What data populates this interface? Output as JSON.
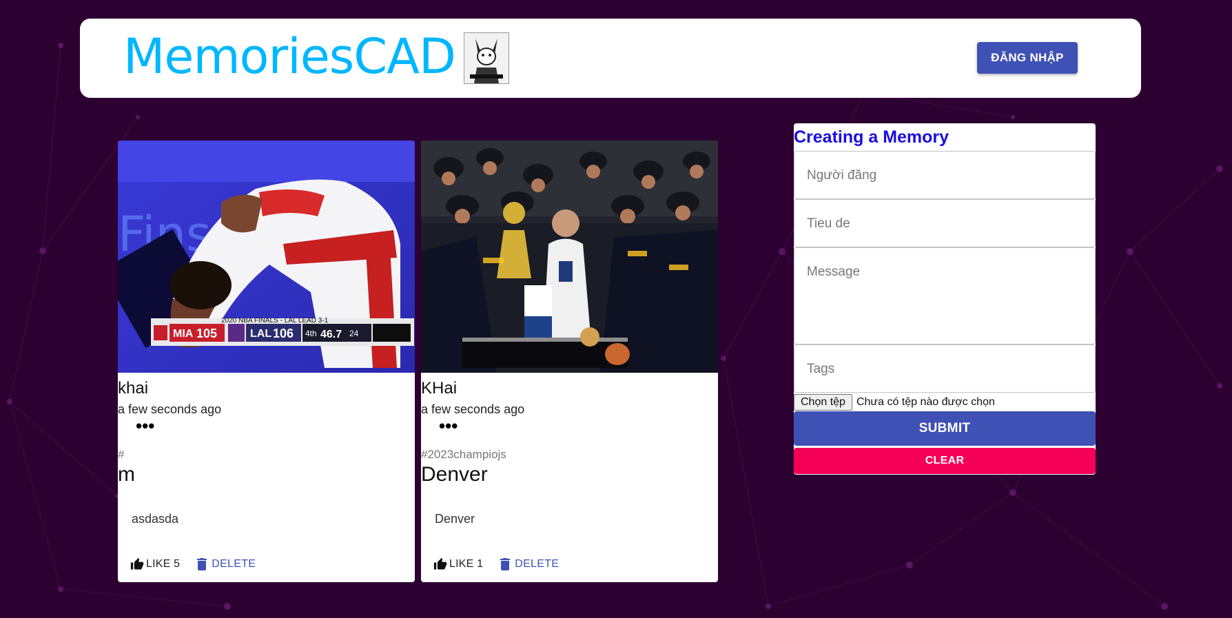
{
  "header": {
    "brand": "MemoriesCAD",
    "login_label": "ĐĂNG NHẬP"
  },
  "posts": [
    {
      "author": "khai",
      "time": "a few seconds ago",
      "more": "•••",
      "tags": "#",
      "title": "m",
      "message": "asdasda",
      "like_label": "LIKE 5",
      "delete_label": "DELETE",
      "image": {
        "scoreboard_header": "2020 NBA FINALS - LAL LEAD 3-1",
        "team1": "MIA",
        "score1": "105",
        "team2": "LAL",
        "score2": "106",
        "quarter": "4th",
        "clock": "46.7",
        "shot_clock": "24"
      }
    },
    {
      "author": "KHai",
      "time": "a few seconds ago",
      "more": "•••",
      "tags": "#2023champiojs",
      "title": "Denver",
      "message": "Denver",
      "like_label": "LIKE 1",
      "delete_label": "DELETE"
    }
  ],
  "form": {
    "title": "Creating a Memory",
    "creator_placeholder": "Người đăng",
    "title_placeholder": "Tieu de",
    "message_placeholder": "Message",
    "tags_placeholder": "Tags",
    "file_button": "Chọn tệp",
    "file_status": "Chưa có tệp nào được chọn",
    "submit_label": "SUBMIT",
    "clear_label": "CLEAR"
  },
  "colors": {
    "background": "#2d0032",
    "brand": "#00b7ff",
    "primary": "#3f51b5",
    "secondary": "#f50057",
    "form_title": "#1a0de0"
  },
  "icons": {
    "like": "thumb-up-icon",
    "delete": "trash-icon",
    "more": "more-horizontal-icon"
  }
}
